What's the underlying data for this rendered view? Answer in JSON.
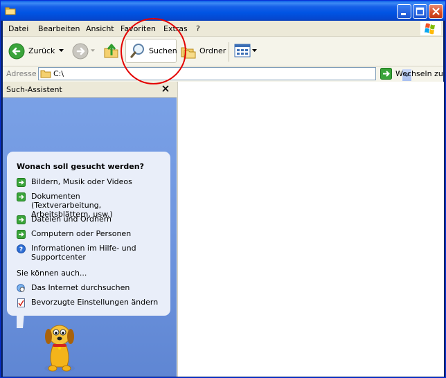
{
  "window": {
    "title": ""
  },
  "menu": {
    "items": [
      "Datei",
      "Bearbeiten",
      "Ansicht",
      "Favoriten",
      "Extras",
      "?"
    ]
  },
  "toolbar": {
    "back_label": "Zurück",
    "search_label": "Suchen",
    "folders_label": "Ordner"
  },
  "address": {
    "label": "Adresse",
    "value": "C:\\",
    "go_label": "Wechseln zu"
  },
  "search_panel": {
    "title": "Such-Assistent",
    "question": "Wonach soll gesucht werden?",
    "options": [
      "Bildern, Musik oder Videos",
      "Dokumenten (Textverarbeitung, Arbeitsblättern, usw.)",
      "Dateien und Ordnern",
      "Computern oder Personen",
      "Informationen im Hilfe- und Supportcenter"
    ],
    "also_label": "Sie können auch...",
    "extra_options": [
      "Das Internet durchsuchen",
      "Bevorzugte Einstellungen ändern"
    ]
  },
  "colors": {
    "titlebar": "#0054e3",
    "panel": "#7ba2e7",
    "annotation": "#e40000"
  }
}
